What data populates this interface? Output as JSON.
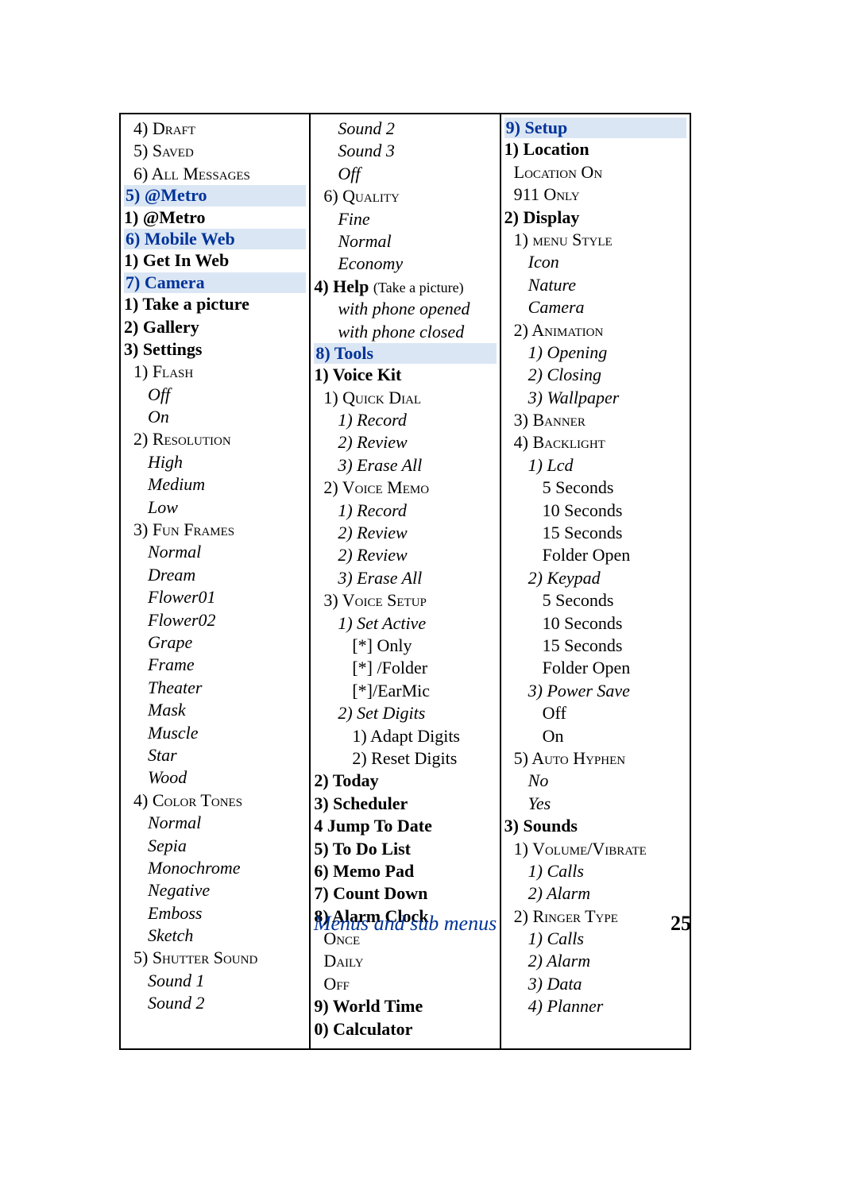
{
  "footer": {
    "title": "Menus and sub menus",
    "page": "25"
  },
  "col1": [
    {
      "t": "4) Draft",
      "c": "i1 sc"
    },
    {
      "t": "5) Saved",
      "c": "i1 sc"
    },
    {
      "t": "6) All Messages",
      "c": "i1 sc"
    },
    {
      "t": "5) @Metro",
      "c": "sec"
    },
    {
      "t": "1) @Metro",
      "c": "b"
    },
    {
      "t": "6) Mobile Web",
      "c": "sec"
    },
    {
      "t": "1) Get In Web",
      "c": "b"
    },
    {
      "t": "7) Camera",
      "c": "sec"
    },
    {
      "t": "1) Take a picture",
      "c": "b"
    },
    {
      "t": "2) Gallery",
      "c": "b"
    },
    {
      "t": "3) Settings",
      "c": "b"
    },
    {
      "t": "1) Flash",
      "c": "i1 sc"
    },
    {
      "t": "Off",
      "c": "i2 it"
    },
    {
      "t": "On",
      "c": "i2 it"
    },
    {
      "t": "2) Resolution",
      "c": "i1 sc"
    },
    {
      "t": "High",
      "c": "i2 it"
    },
    {
      "t": "Medium",
      "c": "i2 it"
    },
    {
      "t": "Low",
      "c": "i2 it"
    },
    {
      "t": "3) Fun Frames",
      "c": "i1 sc"
    },
    {
      "t": "Normal",
      "c": "i2 it"
    },
    {
      "t": "Dream",
      "c": "i2 it"
    },
    {
      "t": "Flower01",
      "c": "i2 it"
    },
    {
      "t": "Flower02",
      "c": "i2 it"
    },
    {
      "t": "Grape",
      "c": "i2 it"
    },
    {
      "t": "Frame",
      "c": "i2 it"
    },
    {
      "t": "Theater",
      "c": "i2 it"
    },
    {
      "t": "Mask",
      "c": "i2 it"
    },
    {
      "t": "Muscle",
      "c": "i2 it"
    },
    {
      "t": "Star",
      "c": "i2 it"
    },
    {
      "t": "Wood",
      "c": "i2 it"
    },
    {
      "t": "4) Color Tones",
      "c": "i1 sc"
    },
    {
      "t": "Normal",
      "c": "i2 it"
    },
    {
      "t": "Sepia",
      "c": "i2 it"
    },
    {
      "t": "Monochrome",
      "c": "i2 it"
    },
    {
      "t": "Negative",
      "c": "i2 it"
    },
    {
      "t": "Emboss",
      "c": "i2 it"
    },
    {
      "t": "Sketch",
      "c": "i2 it"
    },
    {
      "t": "5) Shutter Sound",
      "c": "i1 sc"
    },
    {
      "t": "Sound 1",
      "c": "i2 it"
    },
    {
      "t": "Sound 2",
      "c": "i2 it"
    }
  ],
  "col2": [
    {
      "t": "Sound 2",
      "c": "i2 it"
    },
    {
      "t": "Sound 3",
      "c": "i2 it"
    },
    {
      "t": "Off",
      "c": "i2 it"
    },
    {
      "t": "6) Quality",
      "c": "i1 sc"
    },
    {
      "t": "Fine",
      "c": "i2 it"
    },
    {
      "t": "Normal",
      "c": "i2 it"
    },
    {
      "t": "Economy",
      "c": "i2 it"
    },
    {
      "html": "<span class='b'>4) Help</span> <span class='paren'>(Take a picture)</span>",
      "c": ""
    },
    {
      "t": "with phone opened",
      "c": "i2 it"
    },
    {
      "t": "with phone closed",
      "c": "i2 it"
    },
    {
      "t": "8) Tools",
      "c": "sec"
    },
    {
      "t": "1) Voice Kit",
      "c": "b"
    },
    {
      "t": "1) Quick Dial",
      "c": "i1 sc"
    },
    {
      "t": "1) Record",
      "c": "i2 it"
    },
    {
      "t": "2) Review",
      "c": "i2 it"
    },
    {
      "t": "3) Erase All",
      "c": "i2 it"
    },
    {
      "t": "2) Voice Memo",
      "c": "i1 sc"
    },
    {
      "t": "1) Record",
      "c": "i2 it"
    },
    {
      "t": "2) Review",
      "c": "i2 it"
    },
    {
      "t": "2) Review",
      "c": "i2 it"
    },
    {
      "t": "3) Erase All",
      "c": "i2 it"
    },
    {
      "t": "3) Voice Setup",
      "c": "i1 sc"
    },
    {
      "t": "1) Set Active",
      "c": "i2 it"
    },
    {
      "t": "[*] Only",
      "c": "i3"
    },
    {
      "t": "[*] /Folder",
      "c": "i3"
    },
    {
      "t": "[*]/EarMic",
      "c": "i3"
    },
    {
      "t": "2) Set Digits",
      "c": "i2 it"
    },
    {
      "t": "1) Adapt Digits",
      "c": "i3"
    },
    {
      "t": "2) Reset Digits",
      "c": "i3"
    },
    {
      "t": "2) Today",
      "c": "b"
    },
    {
      "t": "3) Scheduler",
      "c": "b"
    },
    {
      "t": "4 Jump To Date",
      "c": "b"
    },
    {
      "t": "5) To Do List",
      "c": "b"
    },
    {
      "t": "6) Memo Pad",
      "c": "b"
    },
    {
      "t": "7) Count Down",
      "c": "b"
    },
    {
      "t": "8) Alarm Clock",
      "c": "b"
    },
    {
      "t": "Once",
      "c": "i1 sc"
    },
    {
      "t": "Daily",
      "c": "i1 sc"
    },
    {
      "t": "Off",
      "c": "i1 sc"
    },
    {
      "t": "9) World Time",
      "c": "b"
    },
    {
      "t": "0) Calculator",
      "c": "b"
    }
  ],
  "col3": [
    {
      "t": "9) Setup",
      "c": "sec"
    },
    {
      "t": "1) Location",
      "c": "b"
    },
    {
      "t": "Location On",
      "c": "i1 sc"
    },
    {
      "t": "911 Only",
      "c": "i1 sc"
    },
    {
      "t": "2) Display",
      "c": "b"
    },
    {
      "t": "1) menu Style",
      "c": "i1 sc"
    },
    {
      "t": "Icon",
      "c": "i2 it"
    },
    {
      "t": "Nature",
      "c": "i2 it"
    },
    {
      "t": "Camera",
      "c": "i2 it"
    },
    {
      "t": "2) Animation",
      "c": "i1 sc"
    },
    {
      "t": "1) Opening",
      "c": "i2 it"
    },
    {
      "t": "2) Closing",
      "c": "i2 it"
    },
    {
      "t": "3) Wallpaper",
      "c": "i2 it"
    },
    {
      "t": "3) Banner",
      "c": "i1 sc"
    },
    {
      "t": "4) Backlight",
      "c": "i1 sc"
    },
    {
      "t": "1) Lcd",
      "c": "i2 it"
    },
    {
      "t": "5 Seconds",
      "c": "i3"
    },
    {
      "t": "10 Seconds",
      "c": "i3"
    },
    {
      "t": "15 Seconds",
      "c": "i3"
    },
    {
      "t": "Folder Open",
      "c": "i3"
    },
    {
      "t": "2) Keypad",
      "c": "i2 it"
    },
    {
      "t": "5 Seconds",
      "c": "i3"
    },
    {
      "t": "10 Seconds",
      "c": "i3"
    },
    {
      "t": "15 Seconds",
      "c": "i3"
    },
    {
      "t": "Folder Open",
      "c": "i3"
    },
    {
      "t": "3) Power Save",
      "c": "i2 it"
    },
    {
      "t": "Off",
      "c": "i3"
    },
    {
      "t": "On",
      "c": "i3"
    },
    {
      "t": "5) Auto Hyphen",
      "c": "i1 sc"
    },
    {
      "t": "No",
      "c": "i2 it"
    },
    {
      "t": "Yes",
      "c": "i2 it"
    },
    {
      "t": "3) Sounds",
      "c": "b"
    },
    {
      "t": "1) Volume/Vibrate",
      "c": "i1 sc"
    },
    {
      "t": "1) Calls",
      "c": "i2 it"
    },
    {
      "t": "2) Alarm",
      "c": "i2 it"
    },
    {
      "t": "2) Ringer Type",
      "c": "i1 sc"
    },
    {
      "t": "1) Calls",
      "c": "i2 it"
    },
    {
      "t": "2) Alarm",
      "c": "i2 it"
    },
    {
      "t": "3) Data",
      "c": "i2 it"
    },
    {
      "t": "4) Planner",
      "c": "i2 it"
    }
  ]
}
